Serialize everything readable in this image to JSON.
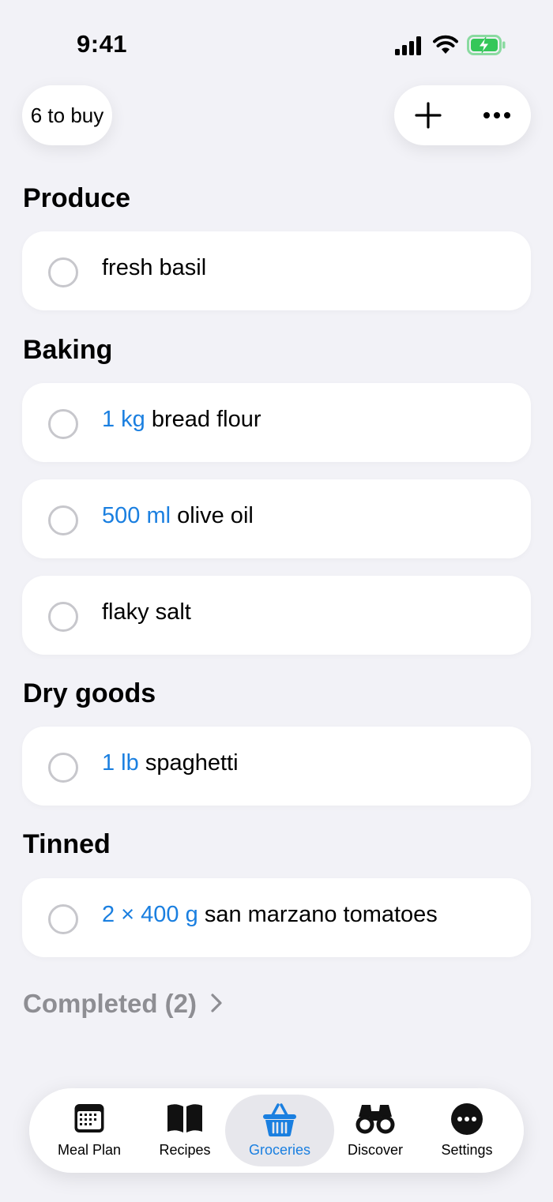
{
  "status_bar": {
    "time": "9:41"
  },
  "header": {
    "to_buy": "6 to buy"
  },
  "sections": [
    {
      "title": "Produce",
      "items": [
        {
          "qty": "",
          "name": "fresh basil"
        }
      ]
    },
    {
      "title": "Baking",
      "items": [
        {
          "qty": "1 kg",
          "name": "bread flour"
        },
        {
          "qty": "500 ml",
          "name": "olive oil"
        },
        {
          "qty": "",
          "name": "flaky salt"
        }
      ]
    },
    {
      "title": "Dry goods",
      "items": [
        {
          "qty": "1 lb",
          "name": "spaghetti"
        }
      ]
    },
    {
      "title": "Tinned",
      "items": [
        {
          "qty": "2 × 400 g",
          "name": "san marzano tomatoes"
        }
      ]
    }
  ],
  "completed": "Completed (2)",
  "tabs": [
    {
      "label": "Meal Plan",
      "icon": "calendar-icon"
    },
    {
      "label": "Recipes",
      "icon": "book-icon"
    },
    {
      "label": "Groceries",
      "icon": "basket-icon",
      "active": true
    },
    {
      "label": "Discover",
      "icon": "binoculars-icon"
    },
    {
      "label": "Settings",
      "icon": "ellipsis-circle-icon"
    }
  ],
  "colors": {
    "accent": "#1a7fe0",
    "background": "#f2f2f7",
    "secondary": "#8e8e93",
    "battery": "#34c759"
  }
}
